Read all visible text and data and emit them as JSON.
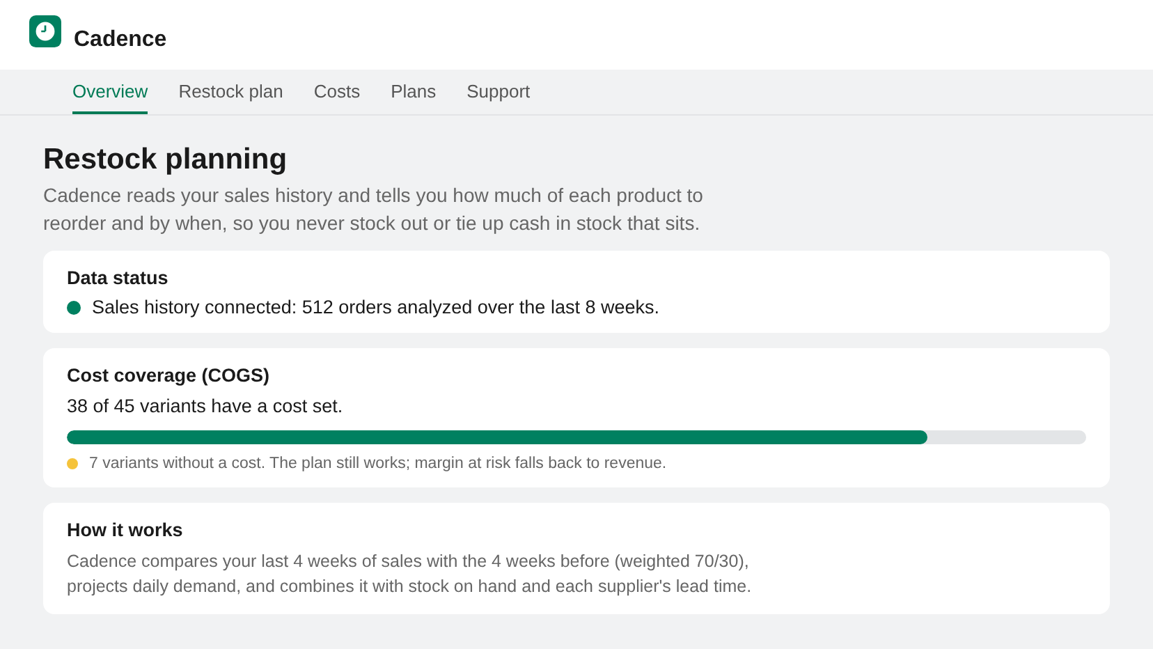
{
  "app": {
    "name": "Cadence"
  },
  "tabs": [
    {
      "label": "Overview",
      "selected": true
    },
    {
      "label": "Restock plan",
      "selected": false
    },
    {
      "label": "Costs",
      "selected": false
    },
    {
      "label": "Plans",
      "selected": false
    },
    {
      "label": "Support",
      "selected": false
    }
  ],
  "page": {
    "title": "Restock planning",
    "description": "Cadence reads your sales history and tells you how much of each product to reorder and by when, so you never stock out or tie up cash in stock that sits."
  },
  "data_status": {
    "title": "Data status",
    "color": "#008060",
    "message": "Sales history connected: 512 orders analyzed over the last 8 weeks."
  },
  "cost_coverage": {
    "title": "Cost coverage (COGS)",
    "summary": "38 of 45 variants have a cost set.",
    "level": 0.844,
    "note": {
      "color": "#f5c33b",
      "text": "7 variants without a cost. The plan still works; margin at risk falls back to revenue."
    }
  },
  "how_it_works": {
    "title": "How it works",
    "text": "Cadence compares your last 4 weeks of sales with the 4 weeks before (weighted 70/30), projects daily demand, and combines it with stock on hand and each supplier's lead time."
  }
}
